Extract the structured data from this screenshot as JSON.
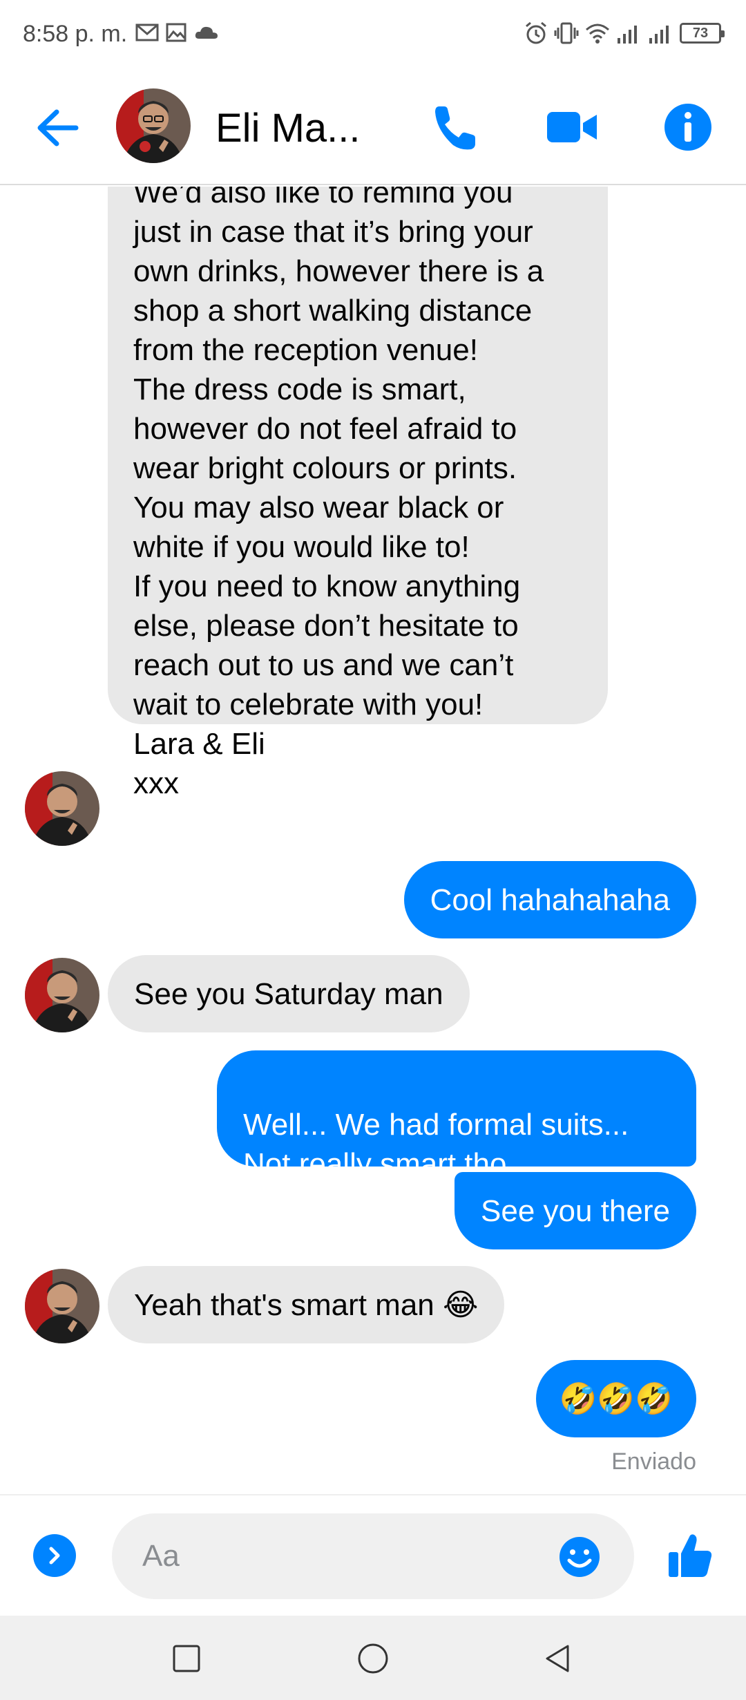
{
  "status_bar": {
    "time": "8:58 p. m.",
    "battery": "73",
    "left_icons": [
      "gmail-icon",
      "gallery-icon",
      "cloud-icon"
    ],
    "right_icons": [
      "alarm-icon",
      "vibrate-icon",
      "wifi-icon",
      "signal-icon",
      "signal-icon",
      "battery-icon"
    ]
  },
  "header": {
    "contact_name": "Eli Ma...",
    "accent_color": "#0084ff"
  },
  "messages": [
    {
      "direction": "in",
      "text": "We’d also like to remind you\njust in case that it’s bring your\nown drinks, however there is a\nshop a short walking distance\nfrom the reception venue!\nThe dress code is smart,\nhowever do not feel afraid to\nwear bright colours or prints.\nYou may also wear black or\nwhite if you would like to!\nIf you need to know anything\nelse, please don’t hesitate to\nreach out to us and we can’t\nwait to celebrate with you!\nLara & Eli\nxxx"
    },
    {
      "direction": "out",
      "text": "Cool hahahahaha"
    },
    {
      "direction": "in",
      "text": "See you Saturday man"
    },
    {
      "direction": "out",
      "text": "Well... We had formal suits...\nNot really smart tho"
    },
    {
      "direction": "out",
      "text": "See you there"
    },
    {
      "direction": "in",
      "text": "Yeah that's smart man 😂"
    },
    {
      "direction": "out",
      "text": "🤣🤣🤣"
    }
  ],
  "sent_status": "Enviado",
  "composer": {
    "placeholder": "Aa"
  }
}
